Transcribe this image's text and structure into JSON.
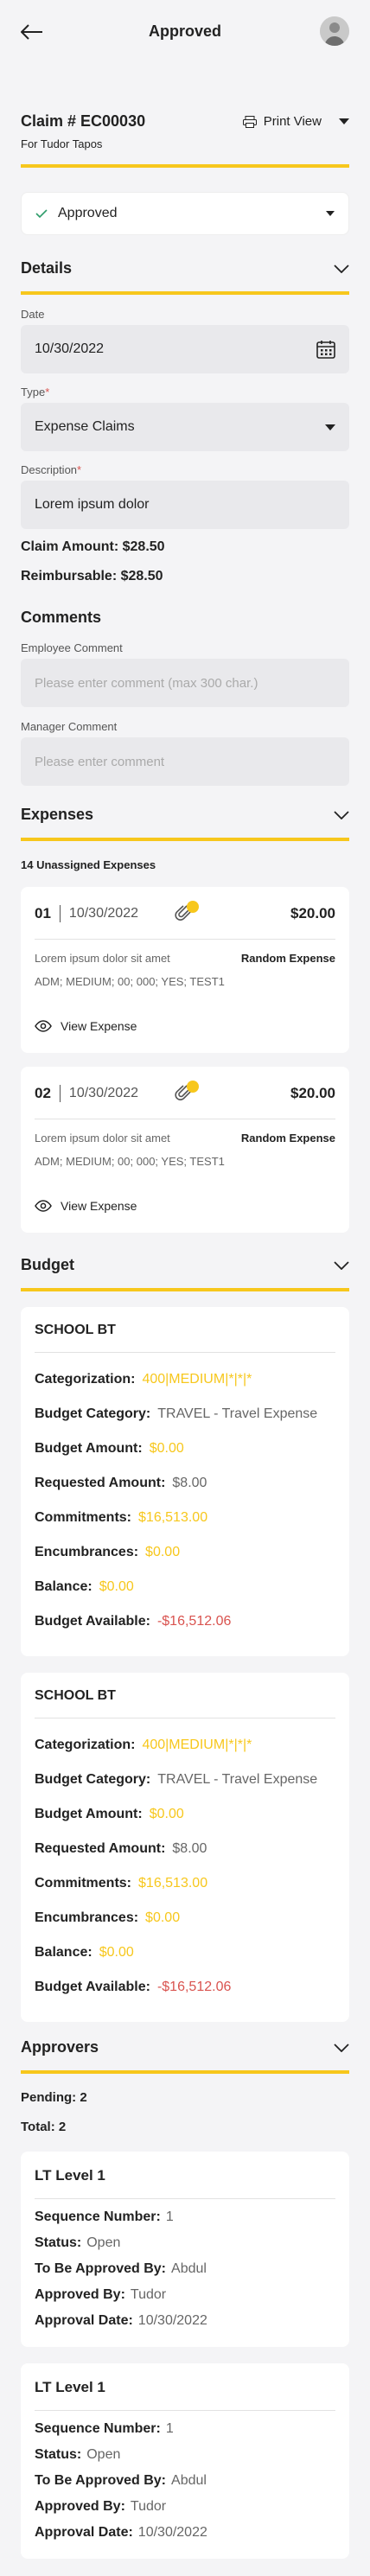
{
  "header": {
    "title": "Approved",
    "back_icon": "arrow-left-icon",
    "avatar_icon": "user-avatar-icon"
  },
  "claim": {
    "title": "Claim # EC00030",
    "subtitle": "For Tudor Tapos",
    "print_label": "Print View"
  },
  "status_select": {
    "value": "Approved"
  },
  "details": {
    "heading": "Details",
    "date_label": "Date",
    "date_value": "10/30/2022",
    "type_label": "Type",
    "type_value": "Expense Claims",
    "description_label": "Description",
    "description_value": "Lorem ipsum dolor",
    "claim_amount": "Claim Amount: $28.50",
    "reimbursable": "Reimbursable: $28.50",
    "required_mark": "*"
  },
  "comments": {
    "heading": "Comments",
    "employee_label": "Employee Comment",
    "employee_placeholder": "Please enter comment (max 300 char.)",
    "manager_label": "Manager Comment",
    "manager_placeholder": "Please enter comment"
  },
  "expenses": {
    "heading": "Expenses",
    "unassigned": "14 Unassigned Expenses",
    "items": [
      {
        "num": "01",
        "date": "10/30/2022",
        "amount": "$20.00",
        "desc": "Lorem ipsum dolor sit amet",
        "type": "Random Expense",
        "code": "ADM; MEDIUM; 00; 000; YES; TEST1",
        "view_label": "View Expense"
      },
      {
        "num": "02",
        "date": "10/30/2022",
        "amount": "$20.00",
        "desc": "Lorem ipsum dolor sit amet",
        "type": "Random Expense",
        "code": "ADM; MEDIUM; 00; 000; YES; TEST1",
        "view_label": "View Expense"
      }
    ]
  },
  "budget": {
    "heading": "Budget",
    "labels": {
      "categorization": "Categorization:",
      "budget_category": "Budget Category:",
      "budget_amount": "Budget Amount:",
      "requested_amount": "Requested Amount:",
      "commitments": "Commitments:",
      "encumbrances": "Encumbrances:",
      "balance": "Balance:",
      "budget_available": "Budget Available:"
    },
    "items": [
      {
        "name": "SCHOOL BT",
        "categorization": "400|MEDIUM|*|*|*",
        "budget_category": "TRAVEL - Travel Expense",
        "budget_amount": "$0.00",
        "requested_amount": "$8.00",
        "commitments": "$16,513.00",
        "encumbrances": "$0.00",
        "balance": "$0.00",
        "budget_available": "-$16,512.06"
      },
      {
        "name": "SCHOOL BT",
        "categorization": "400|MEDIUM|*|*|*",
        "budget_category": "TRAVEL - Travel Expense",
        "budget_amount": "$0.00",
        "requested_amount": "$8.00",
        "commitments": "$16,513.00",
        "encumbrances": "$0.00",
        "balance": "$0.00",
        "budget_available": "-$16,512.06"
      }
    ]
  },
  "approvers": {
    "heading": "Approvers",
    "pending": "Pending: 2",
    "total": "Total: 2",
    "labels": {
      "sequence": "Sequence Number:",
      "status": "Status:",
      "to_be_approved_by": "To Be Approved By:",
      "approved_by": "Approved By:",
      "approval_date": "Approval Date:"
    },
    "items": [
      {
        "name": "LT Level 1",
        "sequence": "1",
        "status": "Open",
        "to_be_approved_by": "Abdul",
        "approved_by": "Tudor",
        "approval_date": "10/30/2022"
      },
      {
        "name": "LT Level 1",
        "sequence": "1",
        "status": "Open",
        "to_be_approved_by": "Abdul",
        "approved_by": "Tudor",
        "approval_date": "10/30/2022"
      }
    ]
  },
  "colors": {
    "accent": "#f7c71c",
    "negative": "#d9534f",
    "check": "#2e9c6a"
  }
}
